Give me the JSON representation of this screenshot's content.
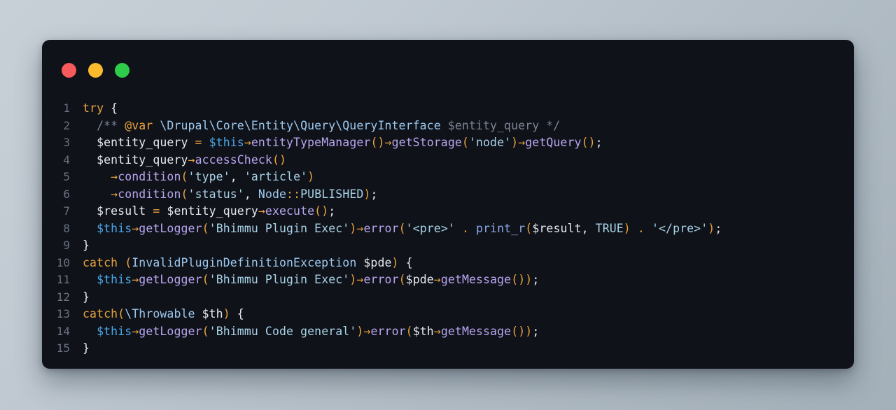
{
  "window": {
    "traffic_lights": [
      {
        "name": "close-button",
        "color": "#f75a5a",
        "label": "Close"
      },
      {
        "name": "minimize-button",
        "color": "#fcbb2d",
        "label": "Minimize"
      },
      {
        "name": "maximize-button",
        "color": "#2fcc4c",
        "label": "Maximize"
      }
    ],
    "background_color": "#0f1219",
    "page_background_start": "#c8d0d7",
    "page_background_end": "#a4b0b9"
  },
  "editor": {
    "language": "php",
    "line_count": 15,
    "gutter_color": "#6a7280",
    "line_numbers": [
      "1",
      "2",
      "3",
      "4",
      "5",
      "6",
      "7",
      "8",
      "9",
      "10",
      "11",
      "12",
      "13",
      "14",
      "15"
    ],
    "lines": [
      {
        "number": "1",
        "text": "try {"
      },
      {
        "number": "2",
        "text": "  /** @var \\Drupal\\Core\\Entity\\Query\\QueryInterface $entity_query */"
      },
      {
        "number": "3",
        "text": "  $entity_query = $this->entityTypeManager()->getStorage('node')->getQuery();"
      },
      {
        "number": "4",
        "text": "  $entity_query->accessCheck()"
      },
      {
        "number": "5",
        "text": "    ->condition('type', 'article')"
      },
      {
        "number": "6",
        "text": "    ->condition('status', Node::PUBLISHED);"
      },
      {
        "number": "7",
        "text": "  $result = $entity_query->execute();"
      },
      {
        "number": "8",
        "text": "  $this->getLogger('Bhimmu Plugin Exec')->error('<pre>' . print_r($result, TRUE) . '</pre>');"
      },
      {
        "number": "9",
        "text": "}"
      },
      {
        "number": "10",
        "text": "catch (InvalidPluginDefinitionException $pde) {"
      },
      {
        "number": "11",
        "text": "  $this->getLogger('Bhimmu Plugin Exec')->error($pde->getMessage());"
      },
      {
        "number": "12",
        "text": "}"
      },
      {
        "number": "13",
        "text": "catch(\\Throwable $th) {"
      },
      {
        "number": "14",
        "text": "  $this->getLogger('Bhimmu Code general')->error($th->getMessage());"
      },
      {
        "number": "15",
        "text": "}"
      }
    ],
    "tokens": {
      "line1": [
        {
          "c": "t-kw",
          "t": "try"
        },
        {
          "c": "t-brace",
          "t": " {"
        }
      ],
      "line2": [
        {
          "c": "t-comment",
          "t": "  /** "
        },
        {
          "c": "t-tag",
          "t": "@var"
        },
        {
          "c": "t-comment",
          "t": " "
        },
        {
          "c": "t-class",
          "t": "\\Drupal\\Core\\Entity\\Query\\QueryInterface"
        },
        {
          "c": "t-comment",
          "t": " $entity_query */"
        }
      ],
      "line3": [
        {
          "c": "t-var",
          "t": "  $entity_query "
        },
        {
          "c": "t-punc",
          "t": "="
        },
        {
          "c": "t-var",
          "t": " "
        },
        {
          "c": "t-this",
          "t": "$this"
        },
        {
          "c": "t-punc",
          "t": "→"
        },
        {
          "c": "t-method",
          "t": "entityTypeManager"
        },
        {
          "c": "t-punc",
          "t": "()"
        },
        {
          "c": "t-punc",
          "t": "→"
        },
        {
          "c": "t-method",
          "t": "getStorage"
        },
        {
          "c": "t-punc",
          "t": "("
        },
        {
          "c": "t-str",
          "t": "'node'"
        },
        {
          "c": "t-punc",
          "t": ")"
        },
        {
          "c": "t-punc",
          "t": "→"
        },
        {
          "c": "t-method",
          "t": "getQuery"
        },
        {
          "c": "t-punc",
          "t": "()"
        },
        {
          "c": "t-var",
          "t": ";"
        }
      ],
      "line4": [
        {
          "c": "t-var",
          "t": "  $entity_query"
        },
        {
          "c": "t-punc",
          "t": "→"
        },
        {
          "c": "t-method",
          "t": "accessCheck"
        },
        {
          "c": "t-punc",
          "t": "()"
        }
      ],
      "line5": [
        {
          "c": "t-var",
          "t": "    "
        },
        {
          "c": "t-punc",
          "t": "→"
        },
        {
          "c": "t-method",
          "t": "condition"
        },
        {
          "c": "t-punc",
          "t": "("
        },
        {
          "c": "t-str",
          "t": "'type'"
        },
        {
          "c": "t-var",
          "t": ", "
        },
        {
          "c": "t-str",
          "t": "'article'"
        },
        {
          "c": "t-punc",
          "t": ")"
        }
      ],
      "line6": [
        {
          "c": "t-var",
          "t": "    "
        },
        {
          "c": "t-punc",
          "t": "→"
        },
        {
          "c": "t-method",
          "t": "condition"
        },
        {
          "c": "t-punc",
          "t": "("
        },
        {
          "c": "t-str",
          "t": "'status'"
        },
        {
          "c": "t-var",
          "t": ", "
        },
        {
          "c": "t-class",
          "t": "Node"
        },
        {
          "c": "t-punc",
          "t": "::"
        },
        {
          "c": "t-const",
          "t": "PUBLISHED"
        },
        {
          "c": "t-punc",
          "t": ")"
        },
        {
          "c": "t-var",
          "t": ";"
        }
      ],
      "line7": [
        {
          "c": "t-var",
          "t": "  $result "
        },
        {
          "c": "t-punc",
          "t": "="
        },
        {
          "c": "t-var",
          "t": " $entity_query"
        },
        {
          "c": "t-punc",
          "t": "→"
        },
        {
          "c": "t-method",
          "t": "execute"
        },
        {
          "c": "t-punc",
          "t": "()"
        },
        {
          "c": "t-var",
          "t": ";"
        }
      ],
      "line8": [
        {
          "c": "t-var",
          "t": "  "
        },
        {
          "c": "t-this",
          "t": "$this"
        },
        {
          "c": "t-punc",
          "t": "→"
        },
        {
          "c": "t-method",
          "t": "getLogger"
        },
        {
          "c": "t-punc",
          "t": "("
        },
        {
          "c": "t-str",
          "t": "'Bhimmu Plugin Exec'"
        },
        {
          "c": "t-punc",
          "t": ")"
        },
        {
          "c": "t-punc",
          "t": "→"
        },
        {
          "c": "t-method",
          "t": "error"
        },
        {
          "c": "t-punc",
          "t": "("
        },
        {
          "c": "t-str",
          "t": "'<pre>'"
        },
        {
          "c": "t-var",
          "t": " "
        },
        {
          "c": "t-punc",
          "t": "."
        },
        {
          "c": "t-var",
          "t": " "
        },
        {
          "c": "t-func",
          "t": "print_r"
        },
        {
          "c": "t-punc",
          "t": "("
        },
        {
          "c": "t-var",
          "t": "$result, "
        },
        {
          "c": "t-const",
          "t": "TRUE"
        },
        {
          "c": "t-punc",
          "t": ")"
        },
        {
          "c": "t-var",
          "t": " "
        },
        {
          "c": "t-punc",
          "t": "."
        },
        {
          "c": "t-var",
          "t": " "
        },
        {
          "c": "t-str",
          "t": "'</pre>'"
        },
        {
          "c": "t-punc",
          "t": ")"
        },
        {
          "c": "t-var",
          "t": ";"
        }
      ],
      "line9": [
        {
          "c": "t-brace",
          "t": "}"
        }
      ],
      "line10": [
        {
          "c": "t-kw",
          "t": "catch"
        },
        {
          "c": "t-var",
          "t": " "
        },
        {
          "c": "t-punc",
          "t": "("
        },
        {
          "c": "t-class",
          "t": "InvalidPluginDefinitionException"
        },
        {
          "c": "t-var",
          "t": " $pde"
        },
        {
          "c": "t-punc",
          "t": ")"
        },
        {
          "c": "t-brace",
          "t": " {"
        }
      ],
      "line11": [
        {
          "c": "t-var",
          "t": "  "
        },
        {
          "c": "t-this",
          "t": "$this"
        },
        {
          "c": "t-punc",
          "t": "→"
        },
        {
          "c": "t-method",
          "t": "getLogger"
        },
        {
          "c": "t-punc",
          "t": "("
        },
        {
          "c": "t-str",
          "t": "'Bhimmu Plugin Exec'"
        },
        {
          "c": "t-punc",
          "t": ")"
        },
        {
          "c": "t-punc",
          "t": "→"
        },
        {
          "c": "t-method",
          "t": "error"
        },
        {
          "c": "t-punc",
          "t": "("
        },
        {
          "c": "t-var",
          "t": "$pde"
        },
        {
          "c": "t-punc",
          "t": "→"
        },
        {
          "c": "t-method",
          "t": "getMessage"
        },
        {
          "c": "t-punc",
          "t": "()"
        },
        {
          "c": "t-punc",
          "t": ")"
        },
        {
          "c": "t-var",
          "t": ";"
        }
      ],
      "line12": [
        {
          "c": "t-brace",
          "t": "}"
        }
      ],
      "line13": [
        {
          "c": "t-kw",
          "t": "catch"
        },
        {
          "c": "t-punc",
          "t": "("
        },
        {
          "c": "t-class",
          "t": "\\Throwable"
        },
        {
          "c": "t-var",
          "t": " $th"
        },
        {
          "c": "t-punc",
          "t": ")"
        },
        {
          "c": "t-brace",
          "t": " {"
        }
      ],
      "line14": [
        {
          "c": "t-var",
          "t": "  "
        },
        {
          "c": "t-this",
          "t": "$this"
        },
        {
          "c": "t-punc",
          "t": "→"
        },
        {
          "c": "t-method",
          "t": "getLogger"
        },
        {
          "c": "t-punc",
          "t": "("
        },
        {
          "c": "t-str",
          "t": "'Bhimmu Code general'"
        },
        {
          "c": "t-punc",
          "t": ")"
        },
        {
          "c": "t-punc",
          "t": "→"
        },
        {
          "c": "t-method",
          "t": "error"
        },
        {
          "c": "t-punc",
          "t": "("
        },
        {
          "c": "t-var",
          "t": "$th"
        },
        {
          "c": "t-punc",
          "t": "→"
        },
        {
          "c": "t-method",
          "t": "getMessage"
        },
        {
          "c": "t-punc",
          "t": "()"
        },
        {
          "c": "t-punc",
          "t": ")"
        },
        {
          "c": "t-var",
          "t": ";"
        }
      ],
      "line15": [
        {
          "c": "t-brace",
          "t": "}"
        }
      ]
    }
  }
}
